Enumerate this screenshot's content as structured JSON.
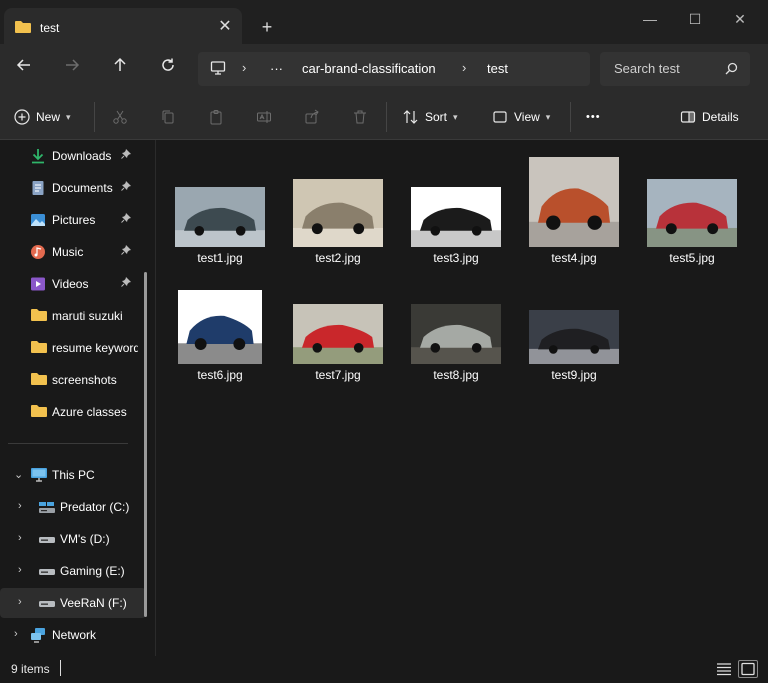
{
  "window": {
    "tab_title": "test",
    "new_tab": "+",
    "close_tab": "✕",
    "controls": {
      "minimize": "—",
      "maximize": "☐",
      "close": "✕"
    }
  },
  "address": {
    "ellipsis": "···",
    "path": [
      "car-brand-classification",
      "test"
    ],
    "search_placeholder": "Search test"
  },
  "toolbar": {
    "new_label": "New",
    "sort_label": "Sort",
    "view_label": "View",
    "more_label": "•••",
    "details_label": "Details"
  },
  "sidebar": {
    "quick_access": [
      {
        "label": "Downloads",
        "icon": "download-icon",
        "pinned": true
      },
      {
        "label": "Documents",
        "icon": "documents-icon",
        "pinned": true
      },
      {
        "label": "Pictures",
        "icon": "pictures-icon",
        "pinned": true
      },
      {
        "label": "Music",
        "icon": "music-icon",
        "pinned": true
      },
      {
        "label": "Videos",
        "icon": "videos-icon",
        "pinned": true
      },
      {
        "label": "maruti suzuki",
        "icon": "folder-icon",
        "pinned": false
      },
      {
        "label": "resume keywords",
        "icon": "folder-icon",
        "pinned": false
      },
      {
        "label": "screenshots",
        "icon": "folder-icon",
        "pinned": false
      },
      {
        "label": "Azure classes",
        "icon": "folder-icon",
        "pinned": false
      }
    ],
    "this_pc": {
      "label": "This PC",
      "icon": "computer-icon",
      "expanded": true
    },
    "drives": [
      {
        "label": "Predator (C:)",
        "icon": "system-drive-icon",
        "selected": false
      },
      {
        "label": "VM's (D:)",
        "icon": "drive-icon",
        "selected": false
      },
      {
        "label": "Gaming (E:)",
        "icon": "drive-icon",
        "selected": false
      },
      {
        "label": "VeeRaN (F:)",
        "icon": "drive-icon",
        "selected": true
      }
    ],
    "network": {
      "label": "Network",
      "icon": "network-icon"
    }
  },
  "files": [
    {
      "name": "test1.jpg",
      "palette": [
        "#9aa7b0",
        "#3d4a50",
        "#d9dde0"
      ]
    },
    {
      "name": "test2.jpg",
      "palette": [
        "#cfc6b3",
        "#8a7f6c",
        "#ece7dc"
      ]
    },
    {
      "name": "test3.jpg",
      "palette": [
        "#ffffff",
        "#1b1b1b",
        "#9a9a9a"
      ]
    },
    {
      "name": "test4.jpg",
      "palette": [
        "#c9c4bd",
        "#b9502c",
        "#8a8782"
      ]
    },
    {
      "name": "test5.jpg",
      "palette": [
        "#a6b4bf",
        "#b8323a",
        "#6d7a54"
      ]
    },
    {
      "name": "test6.jpg",
      "palette": [
        "#ffffff",
        "#1f3c6a",
        "#2b2b2b"
      ]
    },
    {
      "name": "test7.jpg",
      "palette": [
        "#c7c3b8",
        "#c9272b",
        "#6a7b4a"
      ]
    },
    {
      "name": "test8.jpg",
      "palette": [
        "#3a3a36",
        "#a5a9a4",
        "#6d6a60"
      ]
    },
    {
      "name": "test9.jpg",
      "palette": [
        "#3a3f48",
        "#1f1f22",
        "#d9d9dc"
      ]
    }
  ],
  "status": {
    "item_count": "9 items"
  },
  "colors": {
    "background": "#191919",
    "chrome": "#2b2b2b",
    "folder": "#f2c14e",
    "accent": "#4aa3df"
  }
}
